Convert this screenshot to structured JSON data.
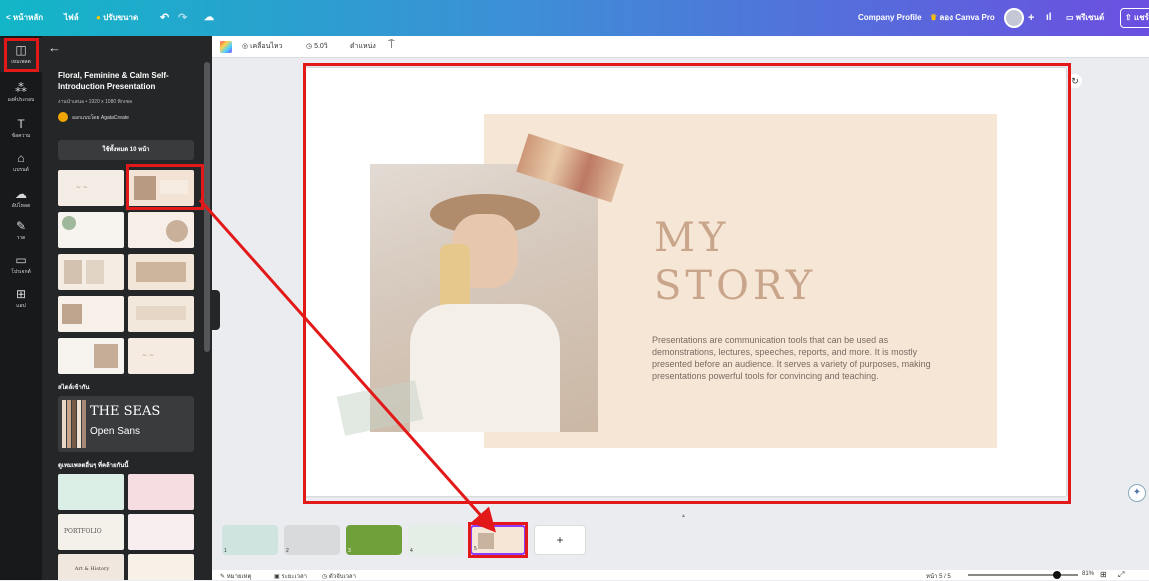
{
  "topbar": {
    "back_label": "< หน้าหลัก",
    "file_label": "ไฟล์",
    "resize_label": "ปรับขนาด",
    "project_title": "Company Profile",
    "pro_label": "ลอง Canva Pro",
    "comment_label": "พรีเซนต์",
    "share_label": "แชร์"
  },
  "rail": {
    "items": [
      {
        "label": "เทมเพลต",
        "icon": "template-icon"
      },
      {
        "label": "องค์ประกอบ",
        "icon": "elements-icon"
      },
      {
        "label": "ข้อความ",
        "icon": "text-icon"
      },
      {
        "label": "แบรนด์",
        "icon": "brand-icon"
      },
      {
        "label": "อัปโหลด",
        "icon": "upload-icon"
      },
      {
        "label": "วาด",
        "icon": "draw-icon"
      },
      {
        "label": "โปรเจกต์",
        "icon": "folder-icon"
      },
      {
        "label": "แอป",
        "icon": "apps-icon"
      }
    ]
  },
  "panel": {
    "title": "Floral, Feminine & Calm Self-Introduction Presentation",
    "meta": "งานนำเสนอ • 1920 x 1080 พิกเซล",
    "author": "ออกแบบโดย AgataCreate",
    "use_all_button": "ใช้ทั้งหมด 10 หน้า",
    "styles_header": "สไตล์เข้ากัน",
    "style_sample_title": "THE SEAS",
    "style_sample_font": "Open Sans",
    "more_header": "ดูเทมเพลตอื่นๆ ที่คล้ายกันนี้",
    "portfolio_label": "PORTFOLIO",
    "art_label": "Art & History"
  },
  "toolbar": {
    "animate_label": "เคลื่อนไหว",
    "time_label": "5.0วิ",
    "position_label": "ตำแหน่ง"
  },
  "slide": {
    "heading_line1": "MY",
    "heading_line2": "STORY",
    "body": "Presentations are communication tools that can be used as demonstrations, lectures, speeches, reports, and more. It is mostly presented before an audience. It serves a variety of purposes, making presentations powerful tools for convincing and teaching."
  },
  "pages": {
    "add_label": "+",
    "numbers": [
      "1",
      "2",
      "3",
      "4",
      "5"
    ]
  },
  "bottom": {
    "notes_label": "หมายเหตุ",
    "duration_label": "ระยะเวลา",
    "timer_label": "ตัวจับเวลา",
    "page_indicator": "หน้า 5 / 5",
    "zoom": "81%",
    "zoom_fraction": 0.81
  },
  "colors": {
    "accent_red": "#e31919",
    "slide_beige": "#f5e6d6",
    "heading_color": "#c9a58b"
  }
}
